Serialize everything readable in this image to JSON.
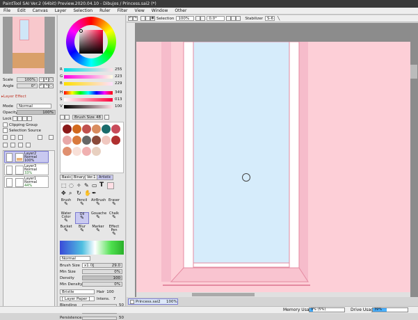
{
  "app": {
    "title": "PaintTool SAI Ver.2 (64bit) Preview.2020.04.10 - Dibujos / Princess.sai2 (*)"
  },
  "menu": [
    "File",
    "Edit",
    "Canvas",
    "Layer",
    "Selection",
    "Ruler",
    "Filter",
    "View",
    "Window",
    "Other"
  ],
  "navigator": {
    "scale_label": "Scale",
    "scale_value": "100%",
    "angle_label": "Angle",
    "angle_value": "0°"
  },
  "layer_effect": {
    "header": "Layer Effect"
  },
  "layer_props": {
    "mode_label": "Mode",
    "mode_value": "Normal",
    "opacity_label": "Opacity",
    "opacity_value": "100%",
    "lock_label": "Lock",
    "clipping": "Clipping Group",
    "selection_source": "Selection Source"
  },
  "layers": [
    {
      "name": "Layer2",
      "mode": "Normal",
      "opacity": "100%"
    },
    {
      "name": "Layer3",
      "mode": "Normal",
      "opacity": "33%"
    },
    {
      "name": "Layer1",
      "mode": "Normal",
      "opacity": "44%"
    }
  ],
  "color": {
    "r_label": "R",
    "r": "255",
    "g_label": "G",
    "g": "223",
    "b_label": "B",
    "b": "229",
    "h_label": "H",
    "h": "349",
    "s_label": "S",
    "s": "013",
    "v_label": "V",
    "v": "100",
    "current": "#ffdfe5"
  },
  "brush_size_bar": {
    "label": "Brush Size",
    "value": "48"
  },
  "swatches": [
    "#8b1a1a",
    "#d2691e",
    "#c0504d",
    "#d98c5f",
    "#1a6b6b",
    "#c84b5a",
    "#e8a8a8",
    "#d97a3d",
    "#666666",
    "#8a4a3a",
    "#f0c8c0",
    "#b03030",
    "#e09070",
    "#f8e0d8",
    "#f0b0b0",
    "#e8d0c0"
  ],
  "tool_tabs": [
    "Basic",
    "Binary",
    "Ver.1",
    "Artistic"
  ],
  "tools": [
    {
      "label": "Brush"
    },
    {
      "label": "Pencil"
    },
    {
      "label": "AirBrush"
    },
    {
      "label": "Eraser"
    },
    {
      "label": "Water Color"
    },
    {
      "label": "Oil"
    },
    {
      "label": "Gouache"
    },
    {
      "label": "Chalk"
    },
    {
      "label": "Bucket"
    },
    {
      "label": "Blur"
    },
    {
      "label": "Marker"
    },
    {
      "label": "Effect Pen"
    }
  ],
  "brush": {
    "mode": "Normal",
    "size_label": "Brush Size",
    "size_mult": "x1.0",
    "size_value": "29.0",
    "min_size_label": "Min Size",
    "min_size_value": "0%",
    "density_label": "Density",
    "density_value": "100",
    "min_density_label": "Min Density",
    "min_density_value": "0%",
    "shape": "Bristle",
    "hair_label": "Hair",
    "hair_value": "100",
    "paper": "[ Layer Paper ]",
    "paper_val": "Intens.",
    "paper_num": "7",
    "blending_label": "Blending",
    "blending_value": "50",
    "dilution_label": "Dilution",
    "dilution_value": "25",
    "persistence_label": "Persistence",
    "persistence_value": "50"
  },
  "canvas_toolbar": {
    "selection_label": "Selection",
    "zoom": "100%",
    "angle": "0.0°",
    "stabilizer_label": "Stabilizer",
    "stabilizer_value": "S-6"
  },
  "doc_tab": {
    "name": "Princess.sai2",
    "zoom": "100%"
  },
  "status": {
    "memory_label": "Memory Usage",
    "memory_value": "9% (5%)",
    "memory_pct": 9,
    "drive_label": "Drive Usage",
    "drive_value": "39%",
    "drive_pct": 39
  }
}
